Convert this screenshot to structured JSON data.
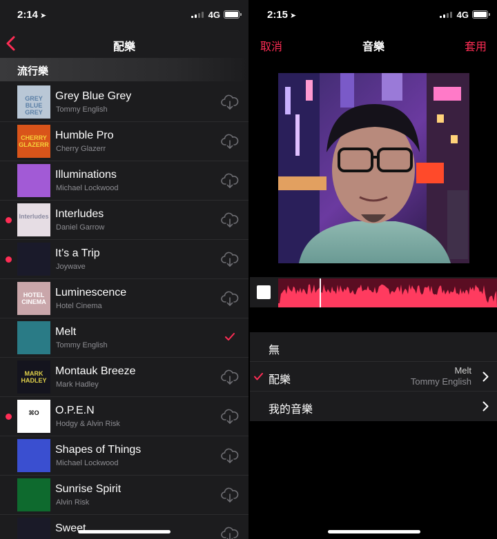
{
  "left_screen": {
    "status": {
      "time": "2:14",
      "network": "4G"
    },
    "nav_title": "配樂",
    "section_header": "流行樂",
    "songs": [
      {
        "title": "Grey Blue Grey",
        "artist": "Tommy English",
        "art_text": "GREY BLUE GREY",
        "art_bg": "#b9c7d6",
        "art_fg": "#5b7fa6",
        "state": "download",
        "new_dot": false
      },
      {
        "title": "Humble Pro",
        "artist": "Cherry Glazerr",
        "art_text": "CHERRY GLAZERR",
        "art_bg": "#d9541a",
        "art_fg": "#f6d23a",
        "state": "download",
        "new_dot": false
      },
      {
        "title": "Illuminations",
        "artist": "Michael Lockwood",
        "art_text": "",
        "art_bg": "#a25ad6",
        "art_fg": "#ffffff",
        "state": "download",
        "new_dot": false
      },
      {
        "title": "Interludes",
        "artist": "Daniel Garrow",
        "art_text": "Interludes",
        "art_bg": "#e6dde4",
        "art_fg": "#8a8aa0",
        "state": "download",
        "new_dot": true
      },
      {
        "title": "It’s a Trip",
        "artist": "Joywave",
        "art_text": "",
        "art_bg": "#1a1a2a",
        "art_fg": "#ff5aa0",
        "state": "download",
        "new_dot": true
      },
      {
        "title": "Luminescence",
        "artist": "Hotel Cinema",
        "art_text": "HOTEL CINEMA",
        "art_bg": "#c9a6aa",
        "art_fg": "#ffffff",
        "state": "download",
        "new_dot": false
      },
      {
        "title": "Melt",
        "artist": "Tommy English",
        "art_text": "",
        "art_bg": "#2a7b86",
        "art_fg": "#ffffff",
        "state": "selected",
        "new_dot": false
      },
      {
        "title": "Montauk Breeze",
        "artist": "Mark Hadley",
        "art_text": "MARK HADLEY",
        "art_bg": "#14141e",
        "art_fg": "#e0d04a",
        "state": "download",
        "new_dot": false
      },
      {
        "title": "O.P.E.N",
        "artist": "Hodgy & Alvin Risk",
        "art_text": "⌘O",
        "art_bg": "#ffffff",
        "art_fg": "#111111",
        "state": "download",
        "new_dot": true
      },
      {
        "title": "Shapes of Things",
        "artist": "Michael Lockwood",
        "art_text": "",
        "art_bg": "#3a4fd0",
        "art_fg": "#ffffff",
        "state": "download",
        "new_dot": false
      },
      {
        "title": "Sunrise Spirit",
        "artist": "Alvin Risk",
        "art_text": "",
        "art_bg": "#0e6a2e",
        "art_fg": "#ffe84a",
        "state": "download",
        "new_dot": false
      },
      {
        "title": "Sweet",
        "artist": "",
        "art_text": "",
        "art_bg": "#1a1a28",
        "art_fg": "#ffffff",
        "state": "download",
        "new_dot": false
      }
    ]
  },
  "right_screen": {
    "status": {
      "time": "2:15",
      "network": "4G"
    },
    "nav_title": "音樂",
    "cancel_label": "取消",
    "apply_label": "套用",
    "options": [
      {
        "label": "無",
        "checked": false,
        "detail_title": "",
        "detail_sub": "",
        "chevron": false
      },
      {
        "label": "配樂",
        "checked": true,
        "detail_title": "Melt",
        "detail_sub": "Tommy English",
        "chevron": true
      },
      {
        "label": "我的音樂",
        "checked": false,
        "detail_title": "",
        "detail_sub": "",
        "chevron": true
      }
    ]
  },
  "colors": {
    "accent": "#ff2d55",
    "list_bg": "#1c1c1e",
    "waveform": "#ff3b5f",
    "waveform_bg": "#5a0d22"
  },
  "icons": {
    "back": "chevron-left-icon",
    "download": "cloud-download-icon",
    "selected": "checkmark-icon",
    "disclosure": "chevron-right-icon"
  }
}
